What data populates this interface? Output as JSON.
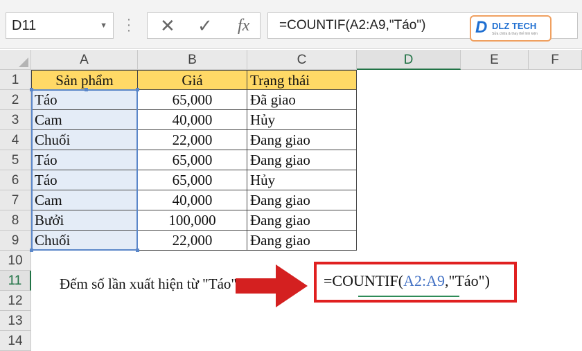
{
  "name_box": "D11",
  "formula_bar": "=COUNTIF(A2:A9,\"Táo\")",
  "fx_buttons": {
    "cancel": "✕",
    "enter": "✓",
    "fx": "fx"
  },
  "logo": {
    "mark": "D",
    "name": "DLZ TECH",
    "tagline": "Sửa chữa & thay thế linh kiện"
  },
  "columns": [
    "A",
    "B",
    "C",
    "D",
    "E",
    "F"
  ],
  "rows": [
    "1",
    "2",
    "3",
    "4",
    "5",
    "6",
    "7",
    "8",
    "9",
    "10",
    "11",
    "12",
    "13",
    "14"
  ],
  "table": {
    "headers": [
      "Sản phẩm",
      "Giá",
      "Trạng thái"
    ],
    "data": [
      [
        "Táo",
        "65,000",
        "Đã giao"
      ],
      [
        "Cam",
        "40,000",
        "Hủy"
      ],
      [
        "Chuối",
        "22,000",
        "Đang giao"
      ],
      [
        "Táo",
        "65,000",
        "Đang giao"
      ],
      [
        "Táo",
        "65,000",
        "Hủy"
      ],
      [
        "Cam",
        "40,000",
        "Đang giao"
      ],
      [
        "Bưởi",
        "100,000",
        "Đang giao"
      ],
      [
        "Chuối",
        "22,000",
        "Đang giao"
      ]
    ]
  },
  "note_text": "Đếm số lần xuất hiện từ \"Táo\" trong",
  "formula_cell": {
    "prefix": "=COUNTIF(",
    "ref": "A2:A9",
    "suffix": ",\"Táo\")"
  },
  "colors": {
    "header_fill": "#ffd966",
    "selection": "#5b87c9",
    "highlight": "#e02020",
    "excel_green": "#217346"
  }
}
